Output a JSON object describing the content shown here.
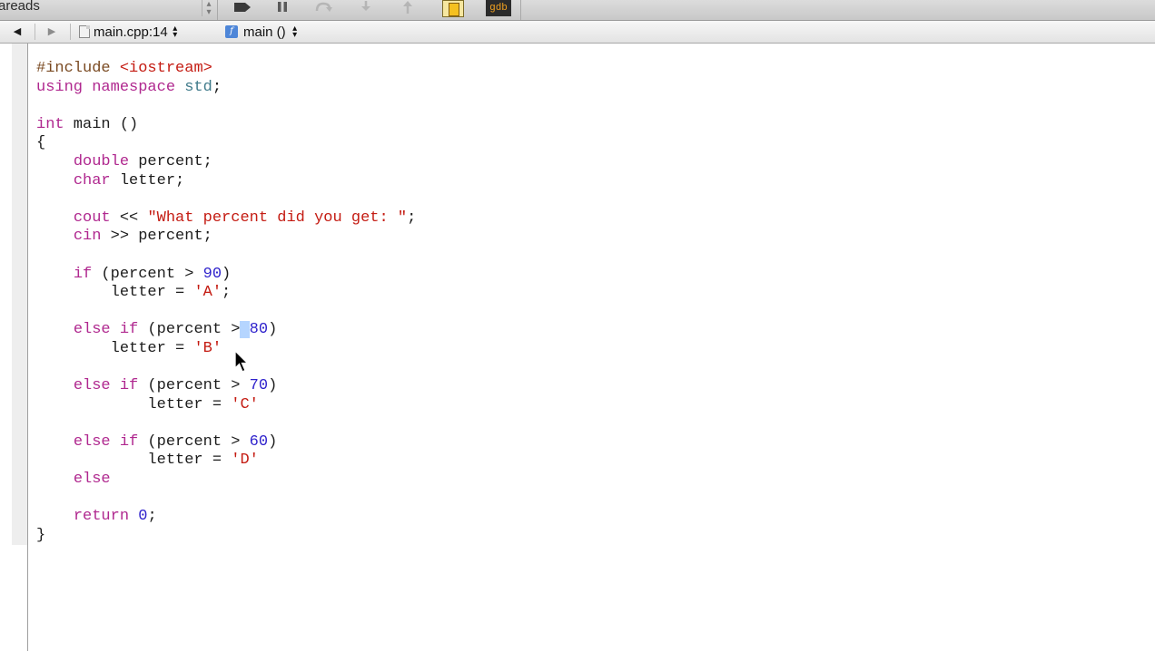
{
  "toolbar": {
    "threads_label": "areads",
    "gdb_label": "gdb"
  },
  "navbar": {
    "back_icon": "back-arrow-icon",
    "forward_icon": "forward-arrow-icon",
    "file_label": "main.cpp:14",
    "function_label": "main ()"
  },
  "editor": {
    "lines": [
      [
        {
          "t": "#include ",
          "c": "pp"
        },
        {
          "t": "<iostream>",
          "c": "str"
        }
      ],
      [
        {
          "t": "using namespace ",
          "c": "kw"
        },
        {
          "t": "std",
          "c": "ty"
        },
        {
          "t": ";",
          "c": ""
        }
      ],
      [],
      [
        {
          "t": "int",
          "c": "kw"
        },
        {
          "t": " main ()",
          "c": ""
        }
      ],
      [
        {
          "t": "{",
          "c": ""
        }
      ],
      [
        {
          "t": "    ",
          "c": ""
        },
        {
          "t": "double",
          "c": "kw"
        },
        {
          "t": " percent;",
          "c": ""
        }
      ],
      [
        {
          "t": "    ",
          "c": ""
        },
        {
          "t": "char",
          "c": "kw"
        },
        {
          "t": " letter;",
          "c": ""
        }
      ],
      [],
      [
        {
          "t": "    ",
          "c": ""
        },
        {
          "t": "cout",
          "c": "kw"
        },
        {
          "t": " << ",
          "c": ""
        },
        {
          "t": "\"What percent did you get: \"",
          "c": "str"
        },
        {
          "t": ";",
          "c": ""
        }
      ],
      [
        {
          "t": "    ",
          "c": ""
        },
        {
          "t": "cin",
          "c": "kw"
        },
        {
          "t": " >> percent;",
          "c": ""
        }
      ],
      [],
      [
        {
          "t": "    ",
          "c": ""
        },
        {
          "t": "if",
          "c": "kw"
        },
        {
          "t": " (percent > ",
          "c": ""
        },
        {
          "t": "90",
          "c": "num"
        },
        {
          "t": ")",
          "c": ""
        }
      ],
      [
        {
          "t": "        letter = ",
          "c": ""
        },
        {
          "t": "'A'",
          "c": "str"
        },
        {
          "t": ";",
          "c": ""
        }
      ],
      [],
      [
        {
          "t": "    ",
          "c": ""
        },
        {
          "t": "else if",
          "c": "kw"
        },
        {
          "t": " (percent >",
          "c": ""
        },
        {
          "t": " ",
          "c": "sel"
        },
        {
          "t": "80",
          "c": "num"
        },
        {
          "t": ")",
          "c": ""
        }
      ],
      [
        {
          "t": "        letter = ",
          "c": ""
        },
        {
          "t": "'B'",
          "c": "str"
        }
      ],
      [],
      [
        {
          "t": "    ",
          "c": ""
        },
        {
          "t": "else if",
          "c": "kw"
        },
        {
          "t": " (percent > ",
          "c": ""
        },
        {
          "t": "70",
          "c": "num"
        },
        {
          "t": ")",
          "c": ""
        }
      ],
      [
        {
          "t": "            letter = ",
          "c": ""
        },
        {
          "t": "'C'",
          "c": "str"
        }
      ],
      [],
      [
        {
          "t": "    ",
          "c": ""
        },
        {
          "t": "else if",
          "c": "kw"
        },
        {
          "t": " (percent > ",
          "c": ""
        },
        {
          "t": "60",
          "c": "num"
        },
        {
          "t": ")",
          "c": ""
        }
      ],
      [
        {
          "t": "            letter = ",
          "c": ""
        },
        {
          "t": "'D'",
          "c": "str"
        }
      ],
      [
        {
          "t": "    ",
          "c": ""
        },
        {
          "t": "else",
          "c": "kw"
        }
      ],
      [],
      [
        {
          "t": "    ",
          "c": ""
        },
        {
          "t": "return",
          "c": "kw"
        },
        {
          "t": " ",
          "c": ""
        },
        {
          "t": "0",
          "c": "num"
        },
        {
          "t": ";",
          "c": ""
        }
      ],
      [
        {
          "t": "}",
          "c": ""
        }
      ]
    ]
  },
  "colors": {
    "keyword": "#b0288f",
    "string": "#c41b12",
    "number": "#2f22cc",
    "preprocessor": "#7a4a22",
    "type": "#3f7a8a",
    "selection": "#b5d5ff"
  }
}
